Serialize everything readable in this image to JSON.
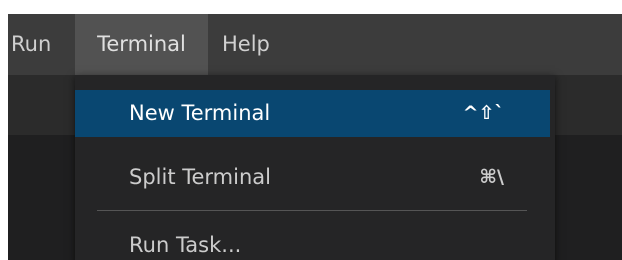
{
  "menubar": {
    "items": [
      {
        "label": "Run"
      },
      {
        "label": "Terminal"
      },
      {
        "label": "Help"
      }
    ]
  },
  "terminal_menu": {
    "items": [
      {
        "label": "New Terminal",
        "shortcut": "^⇧`",
        "highlighted": true
      },
      {
        "label": "Split Terminal",
        "shortcut": "⌘\\"
      },
      {
        "label": "Run Task..."
      }
    ]
  },
  "colors": {
    "menubar_bg": "#3c3c3c",
    "active_menu_bg": "#525252",
    "dropdown_bg": "#252526",
    "highlight_bg": "#094771",
    "text": "#cccccc"
  }
}
